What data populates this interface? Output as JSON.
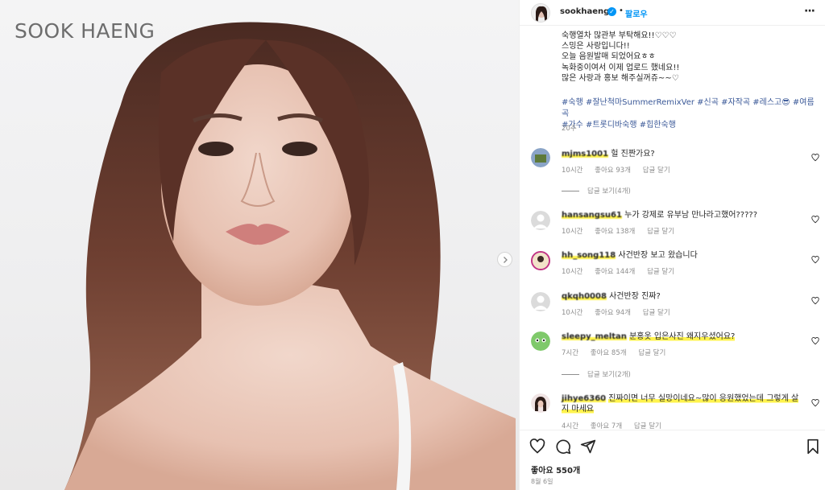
{
  "photo": {
    "watermark": "SOOK HAENG",
    "next_icon": "chevron-right-icon"
  },
  "header": {
    "username": "sookhaeng",
    "separator": "•",
    "follow_label": "팔로우",
    "more_icon": "more-horizontal-icon",
    "verified_icon": "verified-badge-icon"
  },
  "caption": {
    "lines": [
      "숙행열차 많관부 부탁해요!!♡♡♡",
      "스밍은 사랑입니다!!",
      "오늘 음원발매 되었어요ㅎㅎ",
      "녹화중이여서 이제 업로드 했네요!!",
      "많은 사랑과 홍보 해주실꺼쥬~~♡"
    ],
    "hashtags_line1": "#숙행 #잘난척마SummerRemixVer #신곡 #자작곡 #레스고😎 #여름곡",
    "hashtags_line2": "#가수 #트롯디바숙행 #힙한숙행",
    "time": "20주"
  },
  "comments": [
    {
      "user": "mjms1001",
      "text": "헐 진짠가요?",
      "time": "10시간",
      "likes": "좋아요 93개",
      "reply": "답글 달기",
      "view_replies": "답글 보기(4개)",
      "highlight": false
    },
    {
      "user": "hansangsu61",
      "text": "누가 강제로 유부남 만나라고했어?????",
      "time": "10시간",
      "likes": "좋아요 138개",
      "reply": "답글 달기",
      "highlight": false
    },
    {
      "user": "hh_song118",
      "text": "사건반장 보고 왔습니다",
      "time": "10시간",
      "likes": "좋아요 144개",
      "reply": "답글 달기",
      "highlight": false
    },
    {
      "user": "qkqh0008",
      "text": "사건반장 진짜?",
      "time": "10시간",
      "likes": "좋아요 94개",
      "reply": "답글 달기",
      "highlight": false
    },
    {
      "user": "sleepy_meltan",
      "text": "분홍옷 입은사진 왜지우셨어요?",
      "time": "7시간",
      "likes": "좋아요 85개",
      "reply": "답글 달기",
      "view_replies": "답글 보기(2개)",
      "highlight": true
    },
    {
      "user": "jihye6360",
      "text_line1": "진짜이면 너무 실망이네요~많이 응원했었는데 그렇게 살",
      "text_line2": "지 마세요",
      "time": "4시간",
      "likes": "좋아요 7개",
      "reply": "답글 달기",
      "highlight": true
    }
  ],
  "actions": {
    "like_icon": "heart-icon",
    "comment_icon": "comment-icon",
    "share_icon": "send-icon",
    "save_icon": "bookmark-icon"
  },
  "likes_count": "좋아요 550개",
  "date": "8월 6일"
}
